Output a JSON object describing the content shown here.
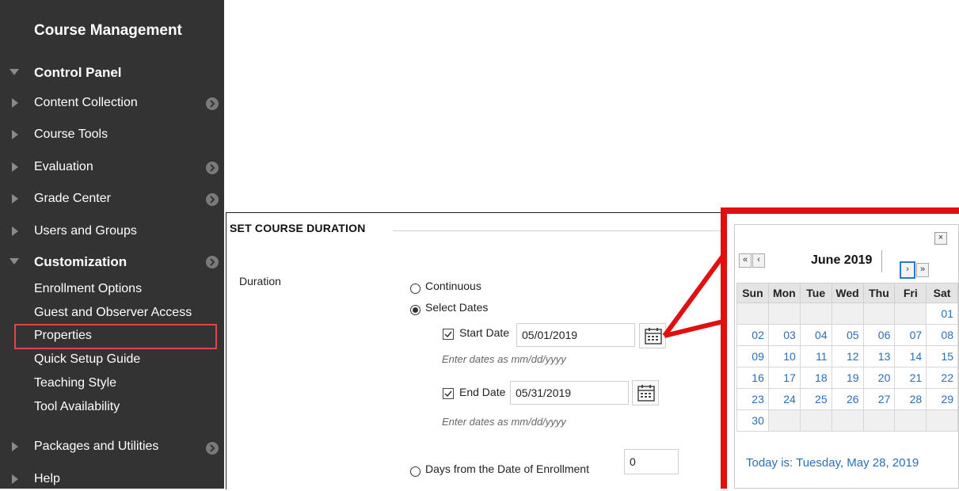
{
  "sidebar": {
    "title": "Course Management",
    "control_panel": "Control Panel",
    "items": [
      {
        "label": "Content Collection"
      },
      {
        "label": "Course Tools"
      },
      {
        "label": "Evaluation"
      },
      {
        "label": "Grade Center"
      },
      {
        "label": "Users and Groups"
      }
    ],
    "customization": "Customization",
    "sub_items": [
      {
        "label": "Enrollment Options"
      },
      {
        "label": "Guest and Observer Access"
      },
      {
        "label": "Properties"
      },
      {
        "label": "Quick Setup Guide"
      },
      {
        "label": "Teaching Style"
      },
      {
        "label": "Tool Availability"
      }
    ],
    "packages": "Packages and Utilities",
    "help": "Help",
    "highlight_color": "#e04545"
  },
  "form": {
    "section_title": "SET COURSE DURATION",
    "duration_label": "Duration",
    "option_continuous": "Continuous",
    "option_select_dates": "Select Dates",
    "start_date_label": "Start Date",
    "start_date_value": "05/01/2019",
    "end_date_label": "End Date",
    "end_date_value": "05/31/2019",
    "date_hint": "Enter dates as mm/dd/yyyy",
    "option_days_from_enrollment": "Days from the Date of Enrollment",
    "days_value": "0",
    "selected_option": "Select Dates"
  },
  "calendar": {
    "month_title": "June 2019",
    "close_label": "×",
    "prev_year": "«",
    "prev_month": "‹",
    "next_month": "›",
    "next_year": "»",
    "weekdays": [
      "Sun",
      "Mon",
      "Tue",
      "Wed",
      "Thu",
      "Fri",
      "Sat"
    ],
    "weeks": [
      [
        "",
        "",
        "",
        "",
        "",
        "",
        "01"
      ],
      [
        "02",
        "03",
        "04",
        "05",
        "06",
        "07",
        "08"
      ],
      [
        "09",
        "10",
        "11",
        "12",
        "13",
        "14",
        "15"
      ],
      [
        "16",
        "17",
        "18",
        "19",
        "20",
        "21",
        "22"
      ],
      [
        "23",
        "24",
        "25",
        "26",
        "27",
        "28",
        "29"
      ],
      [
        "30",
        "",
        "",
        "",
        "",
        "",
        ""
      ]
    ],
    "today_text": "Today is: Tuesday, May 28, 2019",
    "callout_color": "#e01010"
  }
}
